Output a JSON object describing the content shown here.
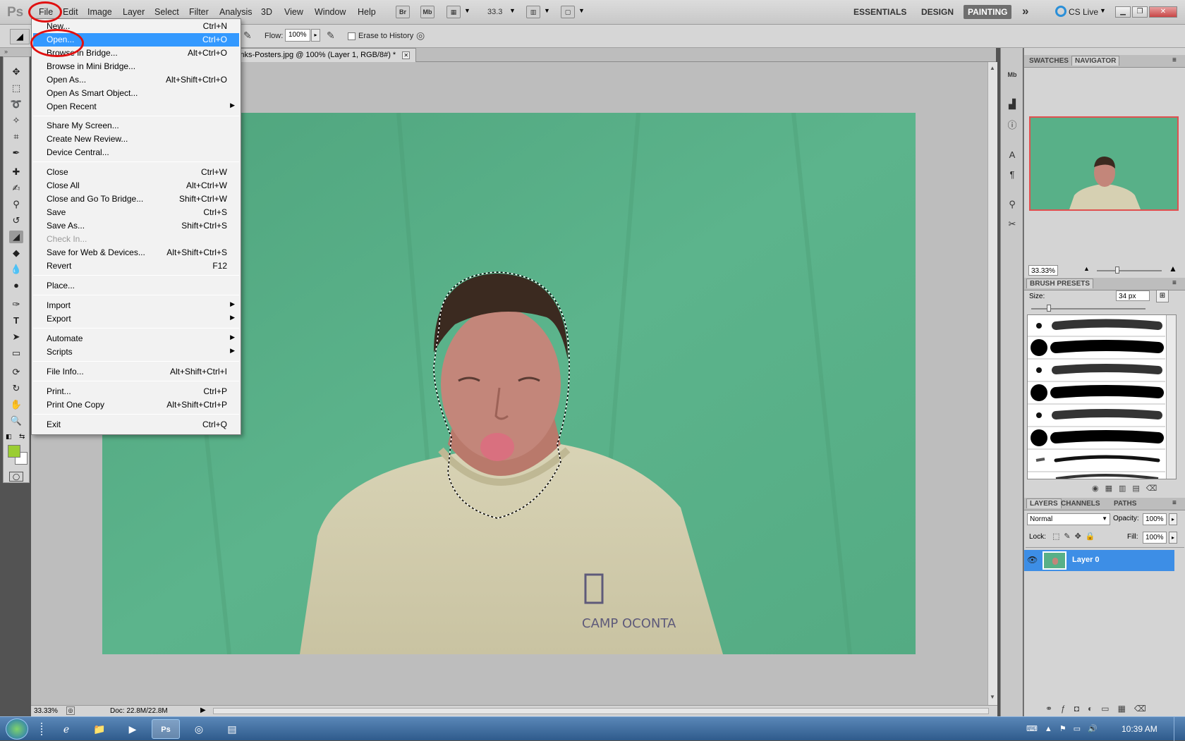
{
  "app": {
    "logo": "Ps"
  },
  "menubar": {
    "items": [
      "File",
      "Edit",
      "Image",
      "Layer",
      "Select",
      "Filter",
      "Analysis",
      "3D",
      "View",
      "Window",
      "Help"
    ],
    "mini_buttons": [
      "Br",
      "Mb"
    ],
    "zoom": "33.3",
    "workspaces": [
      "ESSENTIALS",
      "DESIGN",
      "PAINTING"
    ],
    "active_workspace": "PAINTING",
    "more": "»",
    "cs_live": "CS Live"
  },
  "options": {
    "flow_label": "Flow:",
    "flow_value": "100%",
    "erase_history_label": "Erase to History"
  },
  "document": {
    "tab_title": "-Jar-Jar-Binks-Posters.jpg @ 100% (Layer 1, RGB/8#) *",
    "shirt_text": "CAMP OCONTA"
  },
  "status": {
    "zoom": "33.33%",
    "doc_size": "Doc: 22.8M/22.8M"
  },
  "file_menu": {
    "items": [
      {
        "label": "New...",
        "shortcut": "Ctrl+N"
      },
      {
        "label": "Open...",
        "shortcut": "Ctrl+O",
        "highlighted": true
      },
      {
        "label": "Browse in Bridge...",
        "shortcut": "Alt+Ctrl+O"
      },
      {
        "label": "Browse in Mini Bridge...",
        "shortcut": ""
      },
      {
        "label": "Open As...",
        "shortcut": "Alt+Shift+Ctrl+O"
      },
      {
        "label": "Open As Smart Object...",
        "shortcut": ""
      },
      {
        "label": "Open Recent",
        "shortcut": "",
        "submenu": true
      },
      {
        "label": "Share My Screen...",
        "shortcut": ""
      },
      {
        "label": "Create New Review...",
        "shortcut": ""
      },
      {
        "label": "Device Central...",
        "shortcut": ""
      },
      {
        "label": "Close",
        "shortcut": "Ctrl+W"
      },
      {
        "label": "Close All",
        "shortcut": "Alt+Ctrl+W"
      },
      {
        "label": "Close and Go To Bridge...",
        "shortcut": "Shift+Ctrl+W"
      },
      {
        "label": "Save",
        "shortcut": "Ctrl+S"
      },
      {
        "label": "Save As...",
        "shortcut": "Shift+Ctrl+S"
      },
      {
        "label": "Check In...",
        "shortcut": "",
        "disabled": true
      },
      {
        "label": "Save for Web & Devices...",
        "shortcut": "Alt+Shift+Ctrl+S"
      },
      {
        "label": "Revert",
        "shortcut": "F12"
      },
      {
        "label": "Place...",
        "shortcut": ""
      },
      {
        "label": "Import",
        "shortcut": "",
        "submenu": true
      },
      {
        "label": "Export",
        "shortcut": "",
        "submenu": true
      },
      {
        "label": "Automate",
        "shortcut": "",
        "submenu": true
      },
      {
        "label": "Scripts",
        "shortcut": "",
        "submenu": true
      },
      {
        "label": "File Info...",
        "shortcut": "Alt+Shift+Ctrl+I"
      },
      {
        "label": "Print...",
        "shortcut": "Ctrl+P"
      },
      {
        "label": "Print One Copy",
        "shortcut": "Alt+Shift+Ctrl+P"
      },
      {
        "label": "Exit",
        "shortcut": "Ctrl+Q"
      }
    ]
  },
  "panels": {
    "top_tabs": [
      "SWATCHES",
      "NAVIGATOR"
    ],
    "navigator_zoom": "33.33%",
    "brush_presets_title": "BRUSH PRESETS",
    "size_label": "Size:",
    "size_value": "34 px",
    "layer_tabs": [
      "LAYERS",
      "CHANNELS",
      "PATHS"
    ],
    "blend_mode": "Normal",
    "opacity_label": "Opacity:",
    "opacity_value": "100%",
    "lock_label": "Lock:",
    "fill_label": "Fill:",
    "fill_value": "100%",
    "layer_name": "Layer 0"
  },
  "colors": {
    "foreground": "#9acd32",
    "background": "#ffffff",
    "green_screen": "#5bb38a",
    "selection_blue": "#3399ff",
    "annotation_red": "#e01010"
  },
  "taskbar": {
    "time": "10:39 AM"
  }
}
